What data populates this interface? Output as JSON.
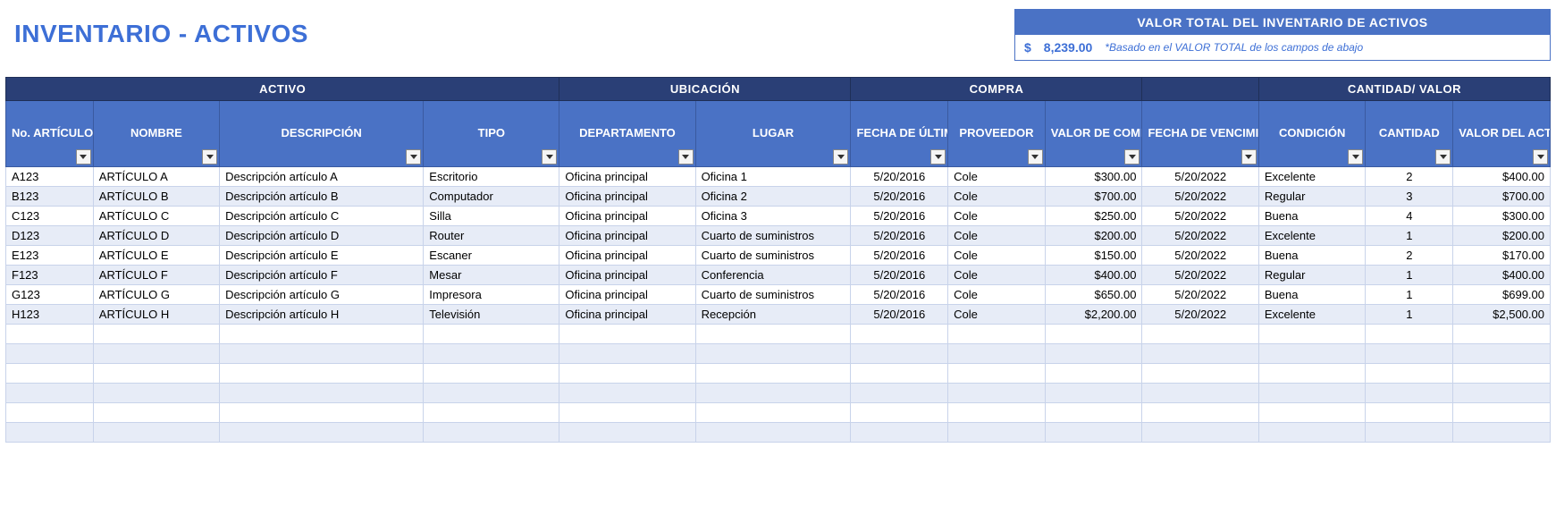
{
  "title": "INVENTARIO - ACTIVOS",
  "summary": {
    "header": "VALOR TOTAL DEL INVENTARIO DE ACTIVOS",
    "currency": "$",
    "value": "8,239.00",
    "note": "*Basado en el VALOR TOTAL de los campos de abajo"
  },
  "groups": {
    "activo": "ACTIVO",
    "ubicacion": "UBICACIÓN",
    "compra": "COMPRA",
    "blank": "",
    "cantidad_valor": "CANTIDAD/ VALOR"
  },
  "columns": {
    "no_articulo": "No. ARTÍCULO",
    "nombre": "NOMBRE",
    "descripcion": "DESCRIPCIÓN",
    "tipo": "TIPO",
    "departamento": "DEPARTAMENTO",
    "lugar": "LUGAR",
    "fecha_ultimo_pedido": "FECHA DE ÚLTIMO PEDIDO",
    "proveedor": "PROVEEDOR",
    "valor_compra_por_articulo": "VALOR DE COMPRA POR ARTÍCULO",
    "fecha_vencimiento_garantia": "FECHA DE VENCIMIENTO DE LA GARANTÍA",
    "condicion": "CONDICIÓN",
    "cantidad": "CANTIDAD",
    "valor_del_activo": "VALOR DEL ACTIVO"
  },
  "rows": [
    {
      "no": "A123",
      "nombre": "ARTÍCULO A",
      "desc": "Descripción artículo A",
      "tipo": "Escritorio",
      "dep": "Oficina principal",
      "lugar": "Oficina 1",
      "fup": "5/20/2016",
      "prov": "Cole",
      "vcpa": "$300.00",
      "fvg": "5/20/2022",
      "cond": "Excelente",
      "cant": "2",
      "val": "$400.00"
    },
    {
      "no": "B123",
      "nombre": "ARTÍCULO B",
      "desc": "Descripción artículo B",
      "tipo": "Computador",
      "dep": "Oficina principal",
      "lugar": "Oficina 2",
      "fup": "5/20/2016",
      "prov": "Cole",
      "vcpa": "$700.00",
      "fvg": "5/20/2022",
      "cond": "Regular",
      "cant": "3",
      "val": "$700.00"
    },
    {
      "no": "C123",
      "nombre": "ARTÍCULO C",
      "desc": "Descripción artículo C",
      "tipo": "Silla",
      "dep": "Oficina principal",
      "lugar": "Oficina 3",
      "fup": "5/20/2016",
      "prov": "Cole",
      "vcpa": "$250.00",
      "fvg": "5/20/2022",
      "cond": "Buena",
      "cant": "4",
      "val": "$300.00"
    },
    {
      "no": "D123",
      "nombre": "ARTÍCULO D",
      "desc": "Descripción artículo D",
      "tipo": "Router",
      "dep": "Oficina principal",
      "lugar": "Cuarto de suministros",
      "fup": "5/20/2016",
      "prov": "Cole",
      "vcpa": "$200.00",
      "fvg": "5/20/2022",
      "cond": "Excelente",
      "cant": "1",
      "val": "$200.00"
    },
    {
      "no": "E123",
      "nombre": "ARTÍCULO E",
      "desc": "Descripción artículo E",
      "tipo": "Escaner",
      "dep": "Oficina principal",
      "lugar": "Cuarto de suministros",
      "fup": "5/20/2016",
      "prov": "Cole",
      "vcpa": "$150.00",
      "fvg": "5/20/2022",
      "cond": "Buena",
      "cant": "2",
      "val": "$170.00"
    },
    {
      "no": "F123",
      "nombre": "ARTÍCULO F",
      "desc": "Descripción artículo F",
      "tipo": "Mesar",
      "dep": "Oficina principal",
      "lugar": "Conferencia",
      "fup": "5/20/2016",
      "prov": "Cole",
      "vcpa": "$400.00",
      "fvg": "5/20/2022",
      "cond": "Regular",
      "cant": "1",
      "val": "$400.00"
    },
    {
      "no": "G123",
      "nombre": "ARTÍCULO G",
      "desc": "Descripción artículo G",
      "tipo": "Impresora",
      "dep": "Oficina principal",
      "lugar": "Cuarto de suministros",
      "fup": "5/20/2016",
      "prov": "Cole",
      "vcpa": "$650.00",
      "fvg": "5/20/2022",
      "cond": "Buena",
      "cant": "1",
      "val": "$699.00"
    },
    {
      "no": "H123",
      "nombre": "ARTÍCULO H",
      "desc": "Descripción artículo H",
      "tipo": "Televisión",
      "dep": "Oficina principal",
      "lugar": "Recepción",
      "fup": "5/20/2016",
      "prov": "Cole",
      "vcpa": "$2,200.00",
      "fvg": "5/20/2022",
      "cond": "Excelente",
      "cant": "1",
      "val": "$2,500.00"
    }
  ],
  "empty_rows": 6,
  "chart_data": {
    "type": "table",
    "title": "INVENTARIO - ACTIVOS",
    "columns": [
      "No. ARTÍCULO",
      "NOMBRE",
      "DESCRIPCIÓN",
      "TIPO",
      "DEPARTAMENTO",
      "LUGAR",
      "FECHA DE ÚLTIMO PEDIDO",
      "PROVEEDOR",
      "VALOR DE COMPRA POR ARTÍCULO",
      "FECHA DE VENCIMIENTO DE LA GARANTÍA",
      "CONDICIÓN",
      "CANTIDAD",
      "VALOR DEL ACTIVO"
    ],
    "rows": [
      [
        "A123",
        "ARTÍCULO A",
        "Descripción artículo A",
        "Escritorio",
        "Oficina principal",
        "Oficina 1",
        "5/20/2016",
        "Cole",
        300.0,
        "5/20/2022",
        "Excelente",
        2,
        400.0
      ],
      [
        "B123",
        "ARTÍCULO B",
        "Descripción artículo B",
        "Computador",
        "Oficina principal",
        "Oficina 2",
        "5/20/2016",
        "Cole",
        700.0,
        "5/20/2022",
        "Regular",
        3,
        700.0
      ],
      [
        "C123",
        "ARTÍCULO C",
        "Descripción artículo C",
        "Silla",
        "Oficina principal",
        "Oficina 3",
        "5/20/2016",
        "Cole",
        250.0,
        "5/20/2022",
        "Buena",
        4,
        300.0
      ],
      [
        "D123",
        "ARTÍCULO D",
        "Descripción artículo D",
        "Router",
        "Oficina principal",
        "Cuarto de suministros",
        "5/20/2016",
        "Cole",
        200.0,
        "5/20/2022",
        "Excelente",
        1,
        200.0
      ],
      [
        "E123",
        "ARTÍCULO E",
        "Descripción artículo E",
        "Escaner",
        "Oficina principal",
        "Cuarto de suministros",
        "5/20/2016",
        "Cole",
        150.0,
        "5/20/2022",
        "Buena",
        2,
        170.0
      ],
      [
        "F123",
        "ARTÍCULO F",
        "Descripción artículo F",
        "Mesar",
        "Oficina principal",
        "Conferencia",
        "5/20/2016",
        "Cole",
        400.0,
        "5/20/2022",
        "Regular",
        1,
        400.0
      ],
      [
        "G123",
        "ARTÍCULO G",
        "Descripción artículo G",
        "Impresora",
        "Oficina principal",
        "Cuarto de suministros",
        "5/20/2016",
        "Cole",
        650.0,
        "5/20/2022",
        "Buena",
        1,
        699.0
      ],
      [
        "H123",
        "ARTÍCULO H",
        "Descripción artículo H",
        "Televisión",
        "Oficina principal",
        "Recepción",
        "5/20/2016",
        "Cole",
        2200.0,
        "5/20/2022",
        "Excelente",
        1,
        2500.0
      ]
    ],
    "total_inventory_value": 8239.0
  }
}
